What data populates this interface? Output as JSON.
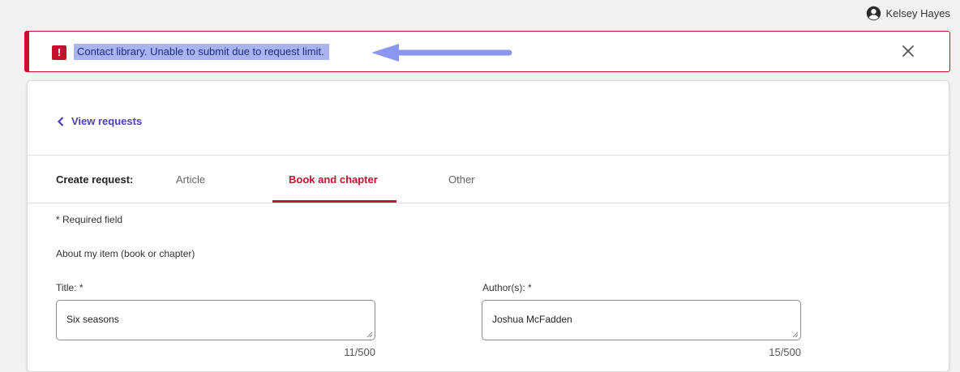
{
  "header": {
    "user_name": "Kelsey Hayes",
    "user_icon": "account-circle-icon"
  },
  "alert": {
    "message": "Contact library. Unable to submit due to request limit.",
    "icon": "error-exclamation-icon",
    "close_icon": "close-icon",
    "accent_color": "#c8102e",
    "highlight_color": "#a9b4ee",
    "arrow_color": "#8a96f0"
  },
  "nav": {
    "back_label": "View requests",
    "back_icon": "chevron-left-icon"
  },
  "tabs": {
    "prefix": "Create request:",
    "items": [
      {
        "label": "Article",
        "active": false
      },
      {
        "label": "Book and chapter",
        "active": true
      },
      {
        "label": "Other",
        "active": false
      }
    ]
  },
  "form": {
    "required_note": "* Required field",
    "section_title": "About my item (book or chapter)",
    "title_field": {
      "label": "Title: *",
      "value": "Six seasons",
      "counter": "11/500"
    },
    "author_field": {
      "label": "Author(s): *",
      "value": "Joshua McFadden",
      "counter": "15/500"
    }
  }
}
